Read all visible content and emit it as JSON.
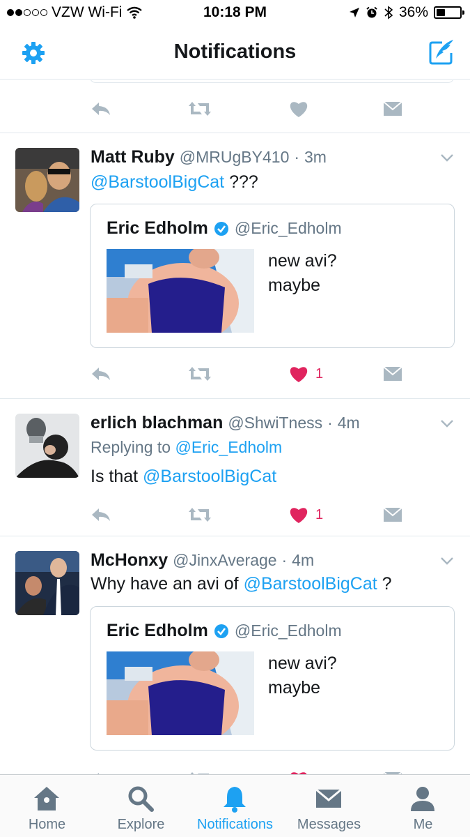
{
  "status_bar": {
    "carrier": "VZW Wi-Fi",
    "time": "10:18 PM",
    "battery": "36%",
    "battery_level": 0.36
  },
  "header": {
    "title": "Notifications"
  },
  "colors": {
    "accent": "#1da1f2",
    "like": "#e0245e",
    "muted": "#aab8c2",
    "secondary_text": "#657786"
  },
  "tweets": [
    {
      "name": "Matt Ruby",
      "handle": "@MRUgBY410",
      "sep": "·",
      "time": "3m",
      "mention": "@BarstoolBigCat",
      "text_after": " ???",
      "quote": {
        "name": "Eric Edholm",
        "handle": "@Eric_Edholm",
        "line1": "new avi?",
        "line2": "maybe"
      },
      "like_count": "1"
    },
    {
      "name": "erlich blachman",
      "handle": "@ShwiTness",
      "sep": "·",
      "time": "4m",
      "replying_prefix": "Replying to ",
      "replying_to": "@Eric_Edholm",
      "text_before": "Is that ",
      "mention": "@BarstoolBigCat",
      "like_count": "1"
    },
    {
      "name": "McHonxy",
      "handle": "@JinxAverage",
      "sep": "·",
      "time": "4m",
      "text_before": "Why have an avi of ",
      "mention": "@BarstoolBigCat",
      "text_after": " ?",
      "quote": {
        "name": "Eric Edholm",
        "handle": "@Eric_Edholm",
        "line1": "new avi?",
        "line2": "maybe"
      }
    }
  ],
  "tabs": [
    {
      "label": "Home",
      "icon": "home-icon"
    },
    {
      "label": "Explore",
      "icon": "search-icon"
    },
    {
      "label": "Notifications",
      "icon": "bell-icon"
    },
    {
      "label": "Messages",
      "icon": "envelope-icon"
    },
    {
      "label": "Me",
      "icon": "person-icon"
    }
  ]
}
